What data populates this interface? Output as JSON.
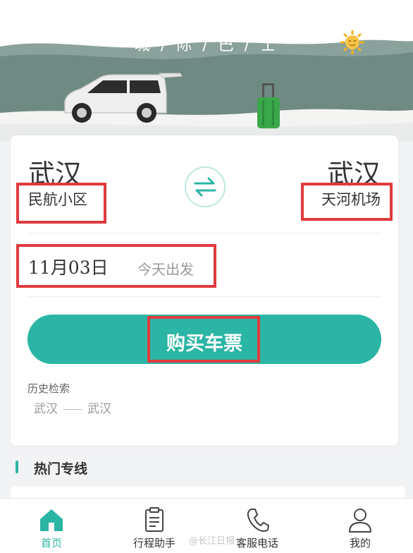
{
  "hero": {
    "title": "城 / 际 / 巴 / 士",
    "sun_icon": "sun-icon",
    "car_icon": "minivan-illustration",
    "luggage_icon": "suitcase-illustration"
  },
  "route": {
    "from_city": "武汉",
    "from_spot": "民航小区",
    "to_city": "武汉",
    "to_spot": "天河机场",
    "swap_icon": "swap-arrows-icon"
  },
  "date": {
    "value": "11月03日",
    "label": "今天出发"
  },
  "buy_button": {
    "label": "购买车票"
  },
  "history": {
    "title": "历史检索",
    "items": [
      {
        "from": "武汉",
        "to": "武汉"
      }
    ]
  },
  "hot_lines": {
    "title": "热门专线"
  },
  "tabbar": {
    "items": [
      {
        "label": "首页",
        "icon": "home-icon",
        "active": true
      },
      {
        "label": "行程助手",
        "icon": "clipboard-icon",
        "active": false
      },
      {
        "label": "客服电话",
        "icon": "phone-icon",
        "active": false
      },
      {
        "label": "我的",
        "icon": "user-icon",
        "active": false
      }
    ]
  },
  "watermark": "@长江日报",
  "colors": {
    "accent": "#2bb5a4",
    "highlight": "#e03a3f",
    "mountain": "#6e8a83"
  }
}
